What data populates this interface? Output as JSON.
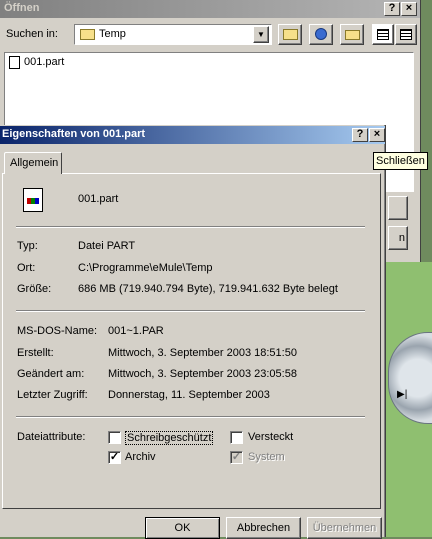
{
  "open_dialog": {
    "title": "Öffnen",
    "look_in_label": "Suchen in:",
    "look_in_value": "Temp",
    "files": [
      "001.part"
    ],
    "toolbar_icons": [
      "up-folder-icon",
      "desktop-icon",
      "new-folder-icon",
      "list-view-icon",
      "details-view-icon"
    ],
    "help_btn": "?",
    "close_btn": "×"
  },
  "props_dialog": {
    "title": "Eigenschaften von 001.part",
    "help_btn": "?",
    "close_btn": "×",
    "tooltip": "Schließen",
    "tab": "Allgemein",
    "filename": "001.part",
    "rows1": [
      {
        "label": "Typ:",
        "value": "Datei PART"
      },
      {
        "label": "Ort:",
        "value": "C:\\Programme\\eMule\\Temp"
      },
      {
        "label": "Größe:",
        "value": "686 MB (719.940.794 Byte), 719.941.632 Byte belegt"
      }
    ],
    "rows2": [
      {
        "label": "MS-DOS-Name:",
        "value": "001~1.PAR"
      },
      {
        "label": "Erstellt:",
        "value": "Mittwoch, 3. September 2003 18:51:50"
      },
      {
        "label": "Geändert am:",
        "value": "Mittwoch, 3. September 2003 23:05:58"
      },
      {
        "label": "Letzter Zugriff:",
        "value": "Donnerstag, 11. September 2003"
      }
    ],
    "attributes_label": "Dateiattribute:",
    "attributes": {
      "readonly": {
        "label": "Schreibgeschützt",
        "checked": false
      },
      "hidden": {
        "label": "Versteckt",
        "checked": false
      },
      "archive": {
        "label": "Archiv",
        "checked": true
      },
      "system": {
        "label": "System",
        "checked": false,
        "disabled": true
      }
    },
    "buttons": {
      "ok": "OK",
      "cancel": "Abbrechen",
      "apply": "Übernehmen"
    }
  },
  "colors": {
    "active_title": "#0a246a",
    "inactive_title": "#808080",
    "face": "#d4d0c8"
  }
}
